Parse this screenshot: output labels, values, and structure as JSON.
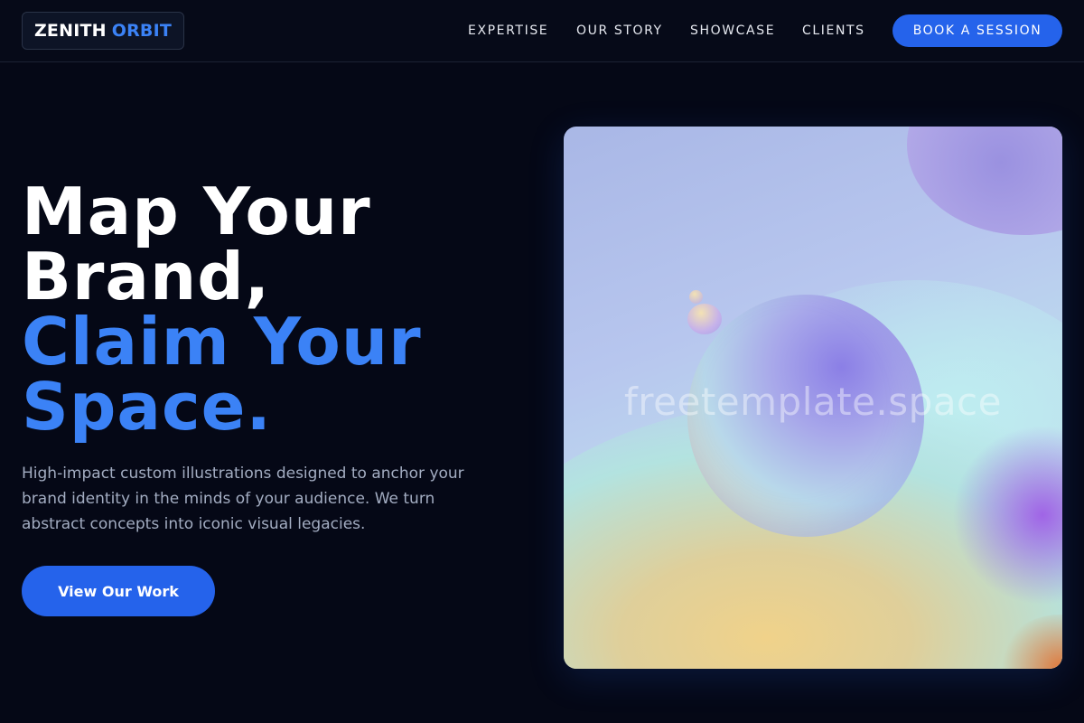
{
  "brand": {
    "word1": "ZENITH",
    "word2": "ORBIT"
  },
  "nav": {
    "items": [
      "EXPERTISE",
      "OUR STORY",
      "SHOWCASE",
      "CLIENTS"
    ],
    "cta_label": "BOOK A SESSION"
  },
  "hero": {
    "line1": "Map Your",
    "line2": "Brand,",
    "line3": "Claim Your",
    "line4": "Space.",
    "description": "High-impact custom illustrations designed to anchor your brand identity in the minds of your audience. We turn abstract concepts into iconic visual legacies.",
    "button_label": "View Our Work"
  },
  "artwork": {
    "watermark": "freetemplate.space"
  },
  "colors": {
    "background": "#050816",
    "accent": "#3b82f6",
    "button": "#2563eb",
    "muted_text": "#a3adc2"
  }
}
